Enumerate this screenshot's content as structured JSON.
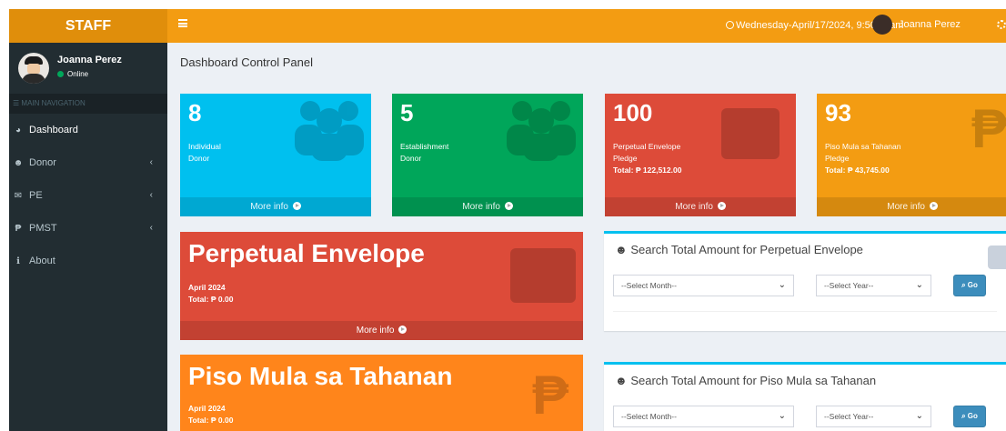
{
  "brand": "STAFF",
  "header": {
    "datetime": "Wednesday-April/17/2024, 9:50:04am",
    "user_name": "Joanna Perez"
  },
  "sidebar": {
    "user_name": "Joanna Perez",
    "status": "Online",
    "nav_header": "MAIN NAVIGATION",
    "items": [
      {
        "label": "Dashboard",
        "icon": "dashboard-icon"
      },
      {
        "label": "Donor",
        "icon": "users-icon"
      },
      {
        "label": "PE",
        "icon": "envelope-icon"
      },
      {
        "label": "PMST",
        "icon": "peso-icon"
      },
      {
        "label": "About",
        "icon": "info-icon"
      }
    ]
  },
  "main": {
    "title": "Dashboard Control Panel",
    "stats": [
      {
        "value": "8",
        "label1": "Individual",
        "label2": "Donor",
        "total": "",
        "footer": "More info",
        "color": "#00c0ef"
      },
      {
        "value": "5",
        "label1": "Establishment",
        "label2": "Donor",
        "total": "",
        "footer": "More info",
        "color": "#00a65a"
      },
      {
        "value": "100",
        "label1": "Perpetual Envelope",
        "label2": "Pledge",
        "total": "Total: ₱ 122,512.00",
        "footer": "More info",
        "color": "#dd4b39"
      },
      {
        "value": "93",
        "label1": "Piso Mula sa Tahanan",
        "label2": "Pledge",
        "total": "Total: ₱ 43,745.00",
        "footer": "More info",
        "color": "#f39c12"
      }
    ],
    "pe_box": {
      "title": "Perpetual Envelope",
      "month": "April 2024",
      "total": "Total: ₱ 0.00",
      "footer": "More info",
      "color": "#dd4b39"
    },
    "pmst_box": {
      "title": "Piso Mula sa Tahanan",
      "month": "April 2024",
      "total": "Total: ₱ 0.00",
      "color": "#ff851b"
    },
    "search_pe": {
      "title": "Search Total Amount for Perpetual Envelope",
      "month_placeholder": "--Select Month--",
      "year_placeholder": "--Select Year--",
      "button": "Go"
    },
    "search_pmst": {
      "title": "Search Total Amount for Piso Mula sa Tahanan",
      "month_placeholder": "--Select Month--",
      "year_placeholder": "--Select Year--",
      "button": "Go"
    }
  }
}
